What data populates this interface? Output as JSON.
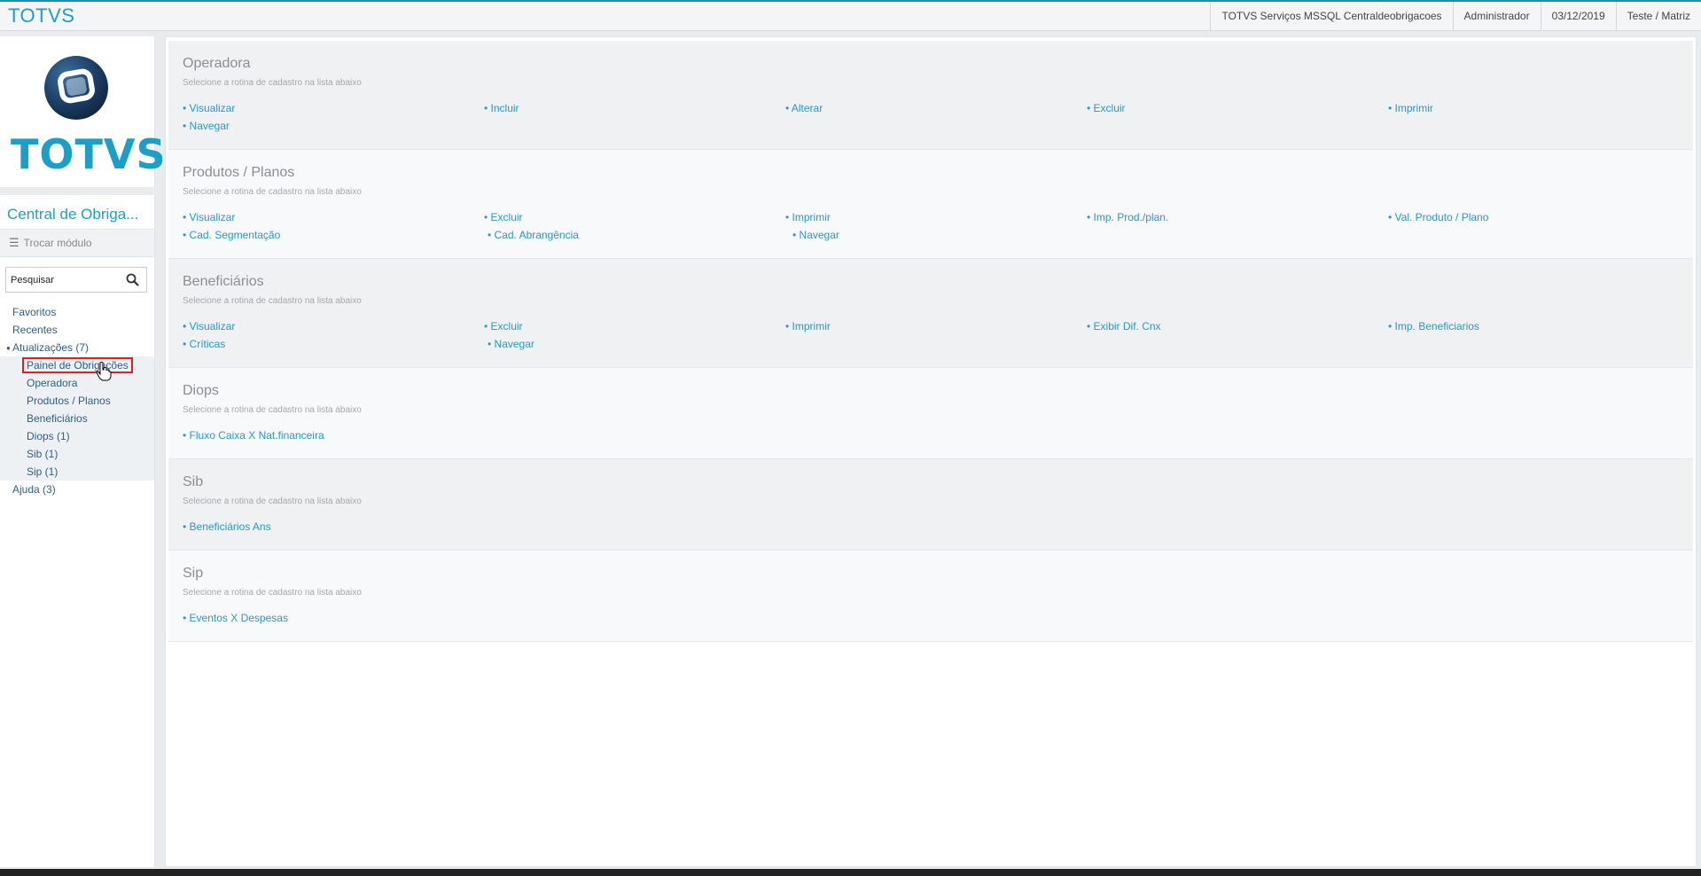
{
  "header": {
    "brand": "TOTVS",
    "environment": "TOTVS Serviços MSSQL Centraldeobrigacoes",
    "user": "Administrador",
    "date": "03/12/2019",
    "company": "Teste / Matriz"
  },
  "logo": {
    "text": "TOTVS"
  },
  "sidebar": {
    "module_title": "Central de Obriga...",
    "switch_module": "Trocar módulo",
    "search": {
      "value": "Pesquisar",
      "placeholder": "Pesquisar"
    },
    "menu": [
      {
        "label": "Favoritos"
      },
      {
        "label": "Recentes"
      },
      {
        "label": "Atualizações (7)"
      },
      {
        "label": "Painel de Obrigações"
      },
      {
        "label": "Operadora"
      },
      {
        "label": "Produtos / Planos"
      },
      {
        "label": "Beneficiários"
      },
      {
        "label": "Diops (1)"
      },
      {
        "label": "Sib (1)"
      },
      {
        "label": "Sip (1)"
      },
      {
        "label": "Ajuda (3)"
      }
    ]
  },
  "sections": [
    {
      "title": "Operadora",
      "subtitle": "Selecione a rotina de cadastro na lista abaixo",
      "links": [
        "Visualizar",
        "Incluir",
        "Alterar",
        "Excluir",
        "Imprimir",
        "Navegar"
      ]
    },
    {
      "title": "Produtos / Planos",
      "subtitle": "Selecione a rotina de cadastro na lista abaixo",
      "links": [
        "Visualizar",
        "Excluir",
        "Imprimir",
        "Imp. Prod./plan.",
        "Val. Produto / Plano",
        "Cad. Segmentação",
        "Cad. Abrangência",
        "Navegar"
      ]
    },
    {
      "title": "Beneficiários",
      "subtitle": "Selecione a rotina de cadastro na lista abaixo",
      "links": [
        "Visualizar",
        "Excluir",
        "Imprimir",
        "Exibir Dif. Cnx",
        "Imp. Beneficiarios",
        "Críticas",
        "Navegar"
      ]
    },
    {
      "title": "Diops",
      "subtitle": "Selecione a rotina de cadastro na lista abaixo",
      "links": [
        "Fluxo Caixa X Nat.financeira"
      ]
    },
    {
      "title": "Sib",
      "subtitle": "Selecione a rotina de cadastro na lista abaixo",
      "links": [
        "Beneficiários Ans"
      ]
    },
    {
      "title": "Sip",
      "subtitle": "Selecione a rotina de cadastro na lista abaixo",
      "links": [
        "Eventos X Despesas"
      ]
    }
  ],
  "colors": {
    "accent": "#1e9fc4",
    "link": "#2a97c6",
    "highlight": "#e02020"
  }
}
